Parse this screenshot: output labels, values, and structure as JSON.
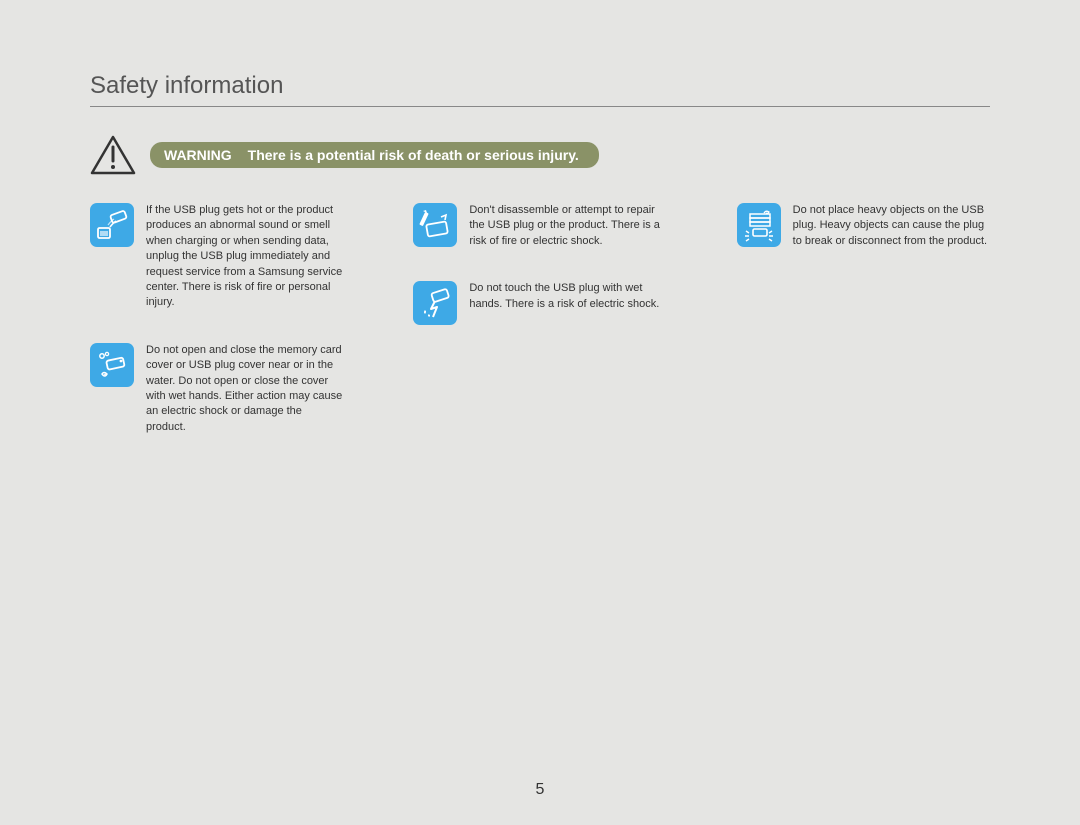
{
  "title": "Safety information",
  "warning": {
    "label": "WARNING",
    "message": "There is a potential risk of death or serious injury."
  },
  "columns": [
    [
      {
        "icon": "usb-hot-icon",
        "text": "If the USB plug gets hot or the product produces an abnormal sound or smell when charging or when sending data, unplug the USB plug immediately and request service from a Samsung service center.\nThere is risk of fire or personal injury."
      },
      {
        "icon": "water-cover-icon",
        "text": "Do not open and close the memory card cover or USB plug cover near or in the water. Do not open or close the cover with wet hands. Either action may cause an electric shock or damage the product."
      }
    ],
    [
      {
        "icon": "disassemble-icon",
        "text": "Don't disassemble or attempt to repair the USB plug or the product. There is a risk of fire or electric shock."
      },
      {
        "icon": "wet-hands-icon",
        "text": "Do not touch the USB plug with wet hands. There is a risk of electric shock."
      }
    ],
    [
      {
        "icon": "heavy-object-icon",
        "text": "Do not place heavy objects on the USB plug. Heavy objects can cause the plug to break or disconnect from the product."
      }
    ]
  ],
  "page_number": "5"
}
